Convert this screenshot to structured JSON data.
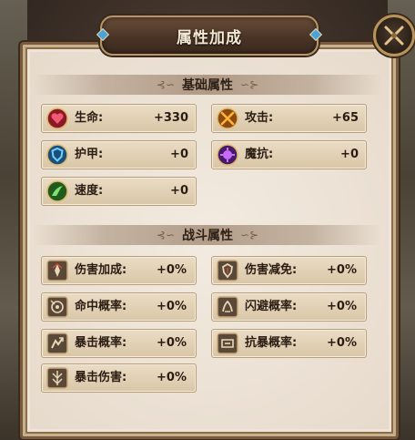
{
  "title": "属性加成",
  "sections": {
    "base": {
      "title": "基础属性"
    },
    "combat": {
      "title": "战斗属性"
    }
  },
  "base_stats": [
    {
      "label": "生命:",
      "value": "+330",
      "icon": "heart-icon",
      "color": "#c7304a"
    },
    {
      "label": "攻击:",
      "value": "+65",
      "icon": "crossed-swords-icon",
      "color": "#d8801c"
    },
    {
      "label": "护甲:",
      "value": "+0",
      "icon": "shield-icon",
      "color": "#2e8fc8"
    },
    {
      "label": "魔抗:",
      "value": "+0",
      "icon": "magic-orb-icon",
      "color": "#8a38b8"
    },
    {
      "label": "速度:",
      "value": "+0",
      "icon": "wing-icon",
      "color": "#3a9a3a"
    }
  ],
  "combat_stats": [
    {
      "label": "伤害加成:",
      "value": "+0%",
      "icon": "damage-bonus-icon"
    },
    {
      "label": "伤害减免:",
      "value": "+0%",
      "icon": "damage-reduction-icon"
    },
    {
      "label": "命中概率:",
      "value": "+0%",
      "icon": "hit-rate-icon"
    },
    {
      "label": "闪避概率:",
      "value": "+0%",
      "icon": "dodge-rate-icon"
    },
    {
      "label": "暴击概率:",
      "value": "+0%",
      "icon": "crit-rate-icon"
    },
    {
      "label": "抗暴概率:",
      "value": "+0%",
      "icon": "crit-resist-icon"
    },
    {
      "label": "暴击伤害:",
      "value": "+0%",
      "icon": "crit-damage-icon"
    }
  ]
}
